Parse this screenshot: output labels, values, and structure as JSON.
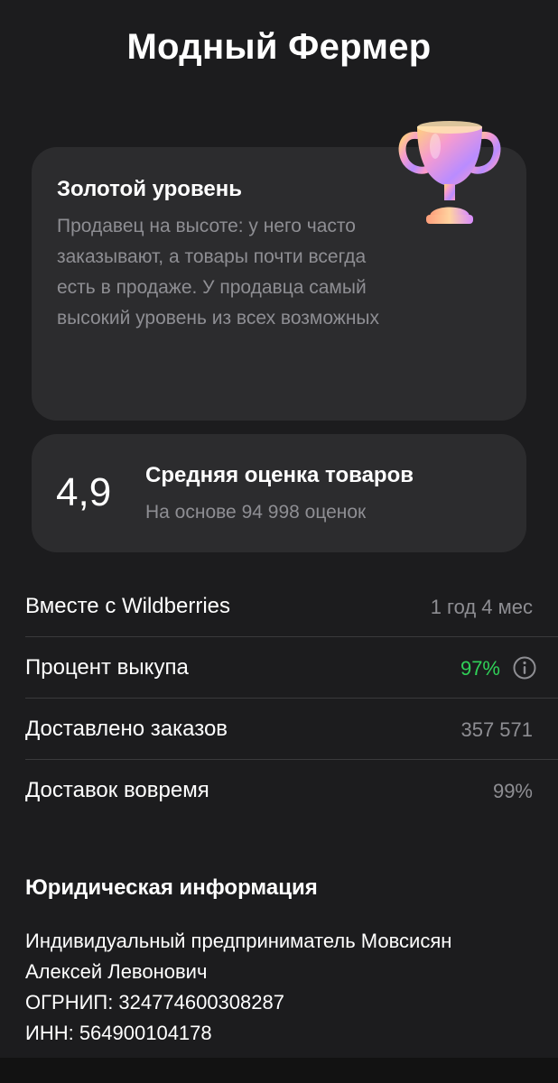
{
  "header": {
    "title": "Модный Фермер"
  },
  "level_card": {
    "title": "Золотой уровень",
    "description": "Продавец на высоте: у него часто заказывают, а товары почти всегда есть в продаже. У продавца самый высокий уровень из всех возможных",
    "icon": "trophy-icon"
  },
  "rating_card": {
    "value": "4,9",
    "title": "Средняя оценка товаров",
    "subtitle": "На основе 94 998 оценок"
  },
  "stats": [
    {
      "label": "Вместе с Wildberries",
      "value": "1 год 4 мес"
    },
    {
      "label": "Процент выкупа",
      "value": "97%",
      "value_color": "#30d158",
      "icon": "info-icon"
    },
    {
      "label": "Доставлено заказов",
      "value": "357 571"
    },
    {
      "label": "Доставок вовремя",
      "value": "99%"
    }
  ],
  "legal": {
    "title": "Юридическая информация",
    "lines": [
      "Индивидуальный предприниматель Мовсисян",
      "Алексей Левонович",
      "ОГРНИП: 324774600308287",
      "ИНН: 564900104178"
    ]
  },
  "colors": {
    "background": "#1c1c1e",
    "card": "#2c2c2e",
    "secondary_text": "#8e8e93",
    "accent_green": "#30d158"
  }
}
